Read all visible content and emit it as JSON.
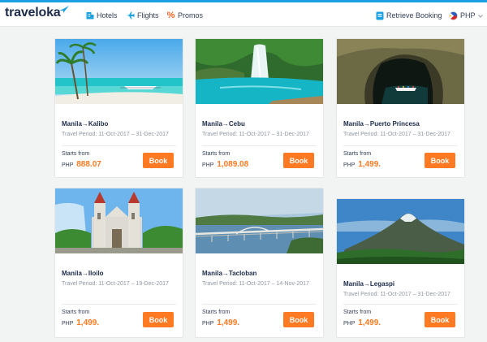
{
  "brand": {
    "name": "traveloka",
    "accent": "#1ba0e2",
    "book_color": "#ff7a22"
  },
  "nav": {
    "hotels": "Hotels",
    "flights": "Flights",
    "promos": "Promos",
    "retrieve": "Retrieve Booking",
    "currency": "PHP"
  },
  "cards": [
    {
      "route": "Manila→Kalibo",
      "period": "Travel Period: 11-Oct-2017 – 31-Dec-2017",
      "starts": "Starts from",
      "currency": "PHP",
      "price": "888.07",
      "book": "Book"
    },
    {
      "route": "Manila→Cebu",
      "period": "Travel Period: 11-Oct-2017 – 31-Dec-2017",
      "starts": "Starts from",
      "currency": "PHP",
      "price": "1,089.08",
      "book": "Book"
    },
    {
      "route": "Manila→Puerto Princesa",
      "period": "Travel Period: 11-Oct-2017 – 31-Dec-2017",
      "starts": "Starts from",
      "currency": "PHP",
      "price": "1,499.",
      "book": "Book"
    },
    {
      "route": "Manila→Iloilo",
      "period": "Travel Period: 11-Oct-2017 – 19-Dec-2017",
      "starts": "Starts from",
      "currency": "PHP",
      "price": "1,499.",
      "book": "Book"
    },
    {
      "route": "Manila→Tacloban",
      "period": "Travel Period: 11-Oct-2017 – 14-Nov-2017",
      "starts": "Starts from",
      "currency": "PHP",
      "price": "1,499.",
      "book": "Book"
    },
    {
      "route": "Manila→Legaspi",
      "period": "Travel Period: 11-Oct-2017 – 31-Dec-2017",
      "starts": "Starts from",
      "currency": "PHP",
      "price": "1,499.",
      "book": "Book"
    }
  ]
}
